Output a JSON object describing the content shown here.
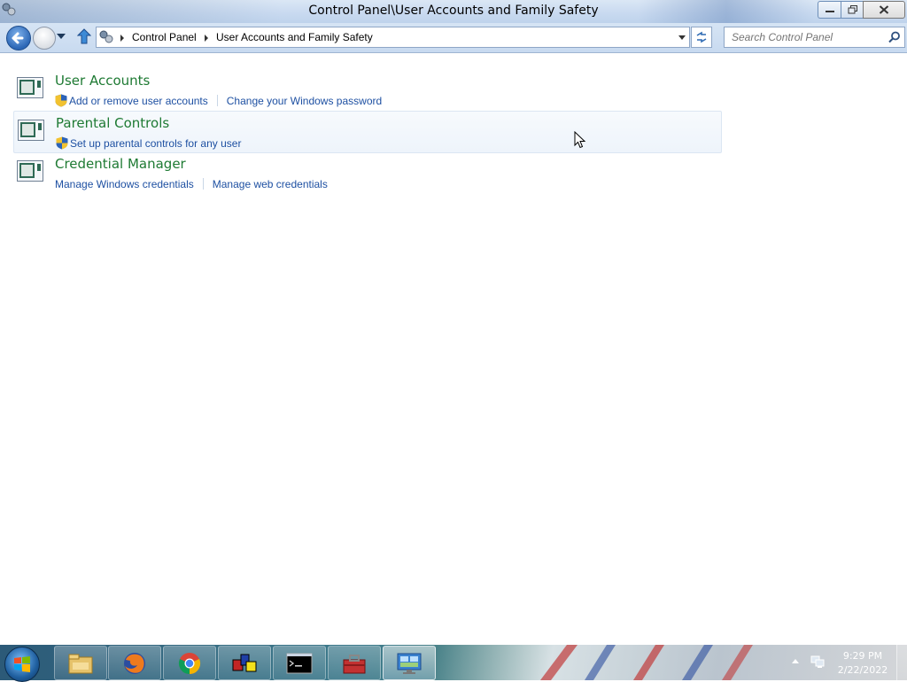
{
  "window": {
    "title": "Control Panel\\User Accounts and Family Safety"
  },
  "navbar": {
    "breadcrumbs": [
      "Control Panel",
      "User Accounts and Family Safety"
    ],
    "search_placeholder": "Search Control Panel"
  },
  "categories": [
    {
      "title": "User Accounts",
      "icon": "user-accounts-icon",
      "links": [
        {
          "label": "Add or remove user accounts",
          "shield": true
        },
        {
          "label": "Change your Windows password",
          "shield": false
        }
      ]
    },
    {
      "title": "Parental Controls",
      "icon": "parental-controls-icon",
      "highlighted": true,
      "links": [
        {
          "label": "Set up parental controls for any user",
          "shield": true
        }
      ]
    },
    {
      "title": "Credential Manager",
      "icon": "credential-manager-icon",
      "links": [
        {
          "label": "Manage Windows credentials",
          "shield": false
        },
        {
          "label": "Manage web credentials",
          "shield": false
        }
      ]
    }
  ],
  "taskbar": {
    "apps": [
      "file-explorer-icon",
      "firefox-icon",
      "chrome-icon",
      "app-red-blue-yellow-icon",
      "command-prompt-icon",
      "toolbox-icon",
      "control-panel-icon"
    ],
    "active_app": "control-panel-icon",
    "clock_time": "9:29 PM",
    "clock_date": "2/22/2022"
  },
  "colors": {
    "category_title": "#1e7a33",
    "link": "#1e50a2",
    "titlebar": "#c9daf0"
  }
}
